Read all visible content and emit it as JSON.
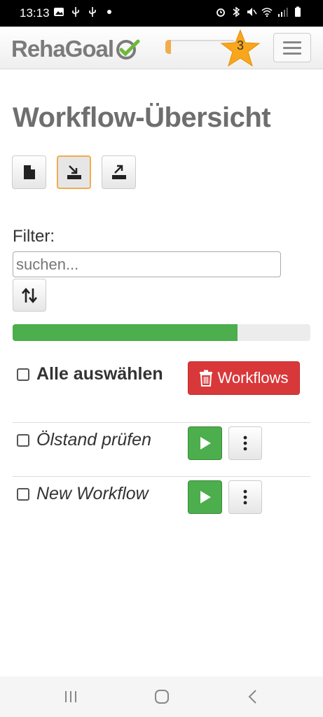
{
  "status_bar": {
    "time": "13:13",
    "left_icons": [
      "image-icon",
      "usb-icon",
      "usb-icon",
      "dot-icon"
    ],
    "right_icons": [
      "alarm-icon",
      "bluetooth-icon",
      "mute-icon",
      "wifi-icon",
      "signal-icon",
      "battery-icon"
    ]
  },
  "header": {
    "logo_text": "RehaGoal",
    "points_progress": 0.08,
    "star_level": "3",
    "menu_icon": "hamburger-icon"
  },
  "page": {
    "title": "Workflow-Übersicht"
  },
  "toolbar": {
    "buttons": [
      {
        "icon": "new-file-icon",
        "active": false
      },
      {
        "icon": "import-icon",
        "active": true
      },
      {
        "icon": "export-icon",
        "active": false
      }
    ]
  },
  "filter": {
    "label": "Filter:",
    "placeholder": "suchen...",
    "value": "",
    "sort_icon": "sort-icon"
  },
  "progress": {
    "value": 0.755
  },
  "select_all": {
    "label": "Alle auswählen",
    "checked": false,
    "delete_label": "Workflows",
    "delete_icon": "trash-icon"
  },
  "workflows": [
    {
      "name": "Ölstand prüfen",
      "checked": false
    },
    {
      "name": "New Workflow",
      "checked": false
    }
  ],
  "colors": {
    "primary_green": "#4cae4c",
    "danger_red": "#d9383a",
    "accent_orange": "#f0ad4e"
  }
}
